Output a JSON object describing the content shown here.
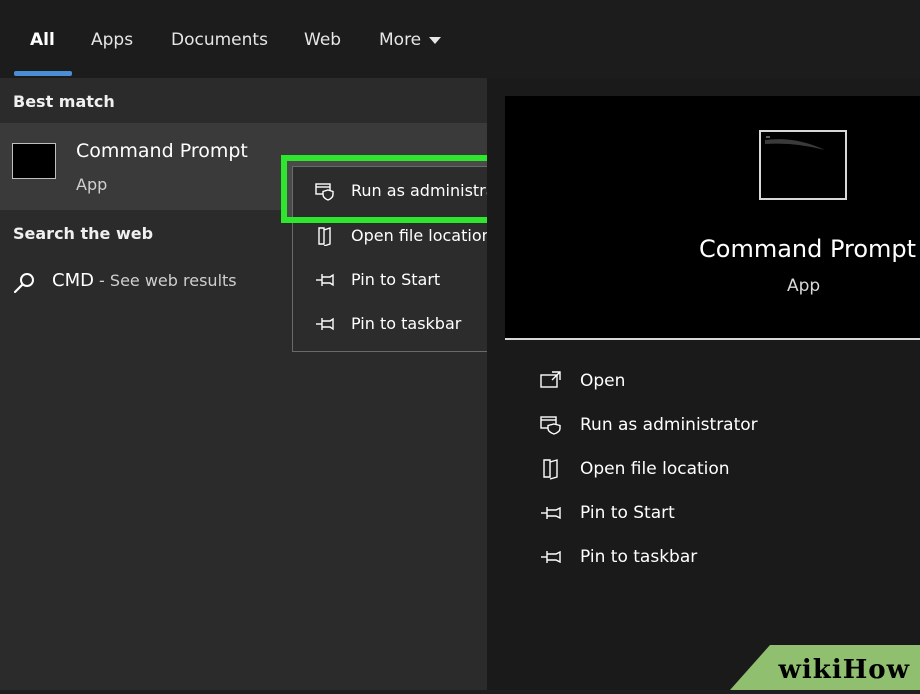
{
  "tabs": {
    "all": "All",
    "apps": "Apps",
    "documents": "Documents",
    "web": "Web",
    "more": "More"
  },
  "left": {
    "best_match_label": "Best match",
    "best_title": "Command Prompt",
    "best_sub": "App",
    "search_web_label": "Search the web",
    "web_title": "CMD",
    "web_sub": " - See web results"
  },
  "context_menu": {
    "items": [
      {
        "label": "Run as administrator",
        "icon": "shield-window-icon"
      },
      {
        "label": "Open file location",
        "icon": "file-location-icon"
      },
      {
        "label": "Pin to Start",
        "icon": "pin-icon"
      },
      {
        "label": "Pin to taskbar",
        "icon": "pin-icon"
      }
    ]
  },
  "preview": {
    "title": "Command Prompt",
    "sub": "App"
  },
  "actions": [
    {
      "label": "Open",
      "icon": "open-icon"
    },
    {
      "label": "Run as administrator",
      "icon": "shield-window-icon"
    },
    {
      "label": "Open file location",
      "icon": "file-location-icon"
    },
    {
      "label": "Pin to Start",
      "icon": "pin-icon"
    },
    {
      "label": "Pin to taskbar",
      "icon": "pin-icon"
    }
  ],
  "watermark": "wikiHow",
  "colors": {
    "highlight": "#2ee62e",
    "tab_underline": "#4a8fd6"
  }
}
